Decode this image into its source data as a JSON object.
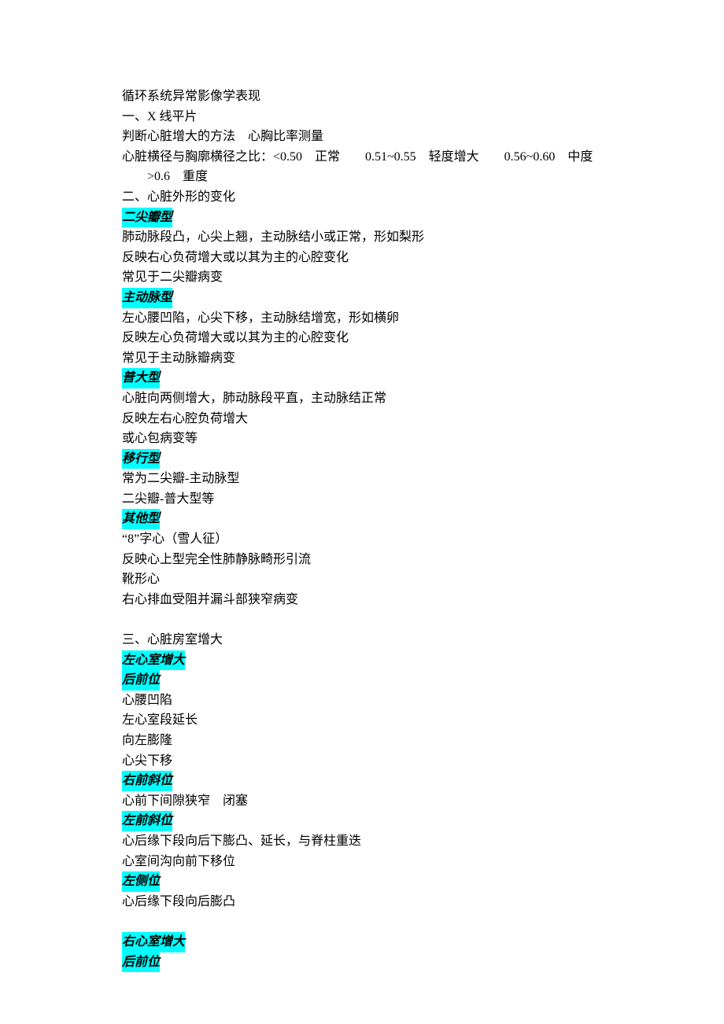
{
  "title": "循环系统异常影像学表现",
  "s1_heading": "一、X 线平片",
  "s1_line1": "判断心脏增大的方法　心胸比率测量",
  "s1_line2": "心脏横径与胸廓横径之比：<0.50　正常　　0.51~0.55　轻度增大　　0.56~0.60　中度",
  "s1_line3": ">0.6　重度",
  "s2_heading": "二、心脏外形的变化",
  "t_mitral": "二尖瓣型",
  "mitral_1": "肺动脉段凸，心尖上翘，主动脉结小或正常，形如梨形",
  "mitral_2": "反映右心负荷增大或以其为主的心腔变化",
  "mitral_3": "常见于二尖瓣病变",
  "t_aortic": "主动脉型",
  "aortic_1": "左心腰凹陷，心尖下移，主动脉结增宽，形如横卵",
  "aortic_2": "反映左心负荷增大或以其为主的心腔变化",
  "aortic_3": "常见于主动脉瓣病变",
  "t_general": "普大型",
  "general_1": "心脏向两侧增大，肺动脉段平直，主动脉结正常",
  "general_2": "反映左右心腔负荷增大",
  "general_3": "或心包病变等",
  "t_trans": "移行型",
  "trans_1": "常为二尖瓣-主动脉型",
  "trans_2": "二尖瓣-普大型等",
  "t_other": "其他型",
  "other_1": "“8”字心（雪人征）",
  "other_2": "反映心上型完全性肺静脉畸形引流",
  "other_3": "靴形心",
  "other_4": "右心排血受阻并漏斗部狭窄病变",
  "s3_heading": "三、心脏房室增大",
  "t_lv": "左心室增大",
  "t_pa": "后前位",
  "lv_pa_1": "心腰凹陷",
  "lv_pa_2": "左心室段延长",
  "lv_pa_3": "向左膨隆",
  "lv_pa_4": "心尖下移",
  "t_rao": "右前斜位",
  "lv_rao_1": "心前下间隙狭窄　闭塞",
  "t_lao": "左前斜位",
  "lv_lao_1": "心后缘下段向后下膨凸、延长，与脊柱重迭",
  "lv_lao_2": "心室间沟向前下移位",
  "t_lat": "左侧位",
  "lv_lat_1": "心后缘下段向后膨凸",
  "t_rv": "右心室增大",
  "t_pa2": "后前位"
}
